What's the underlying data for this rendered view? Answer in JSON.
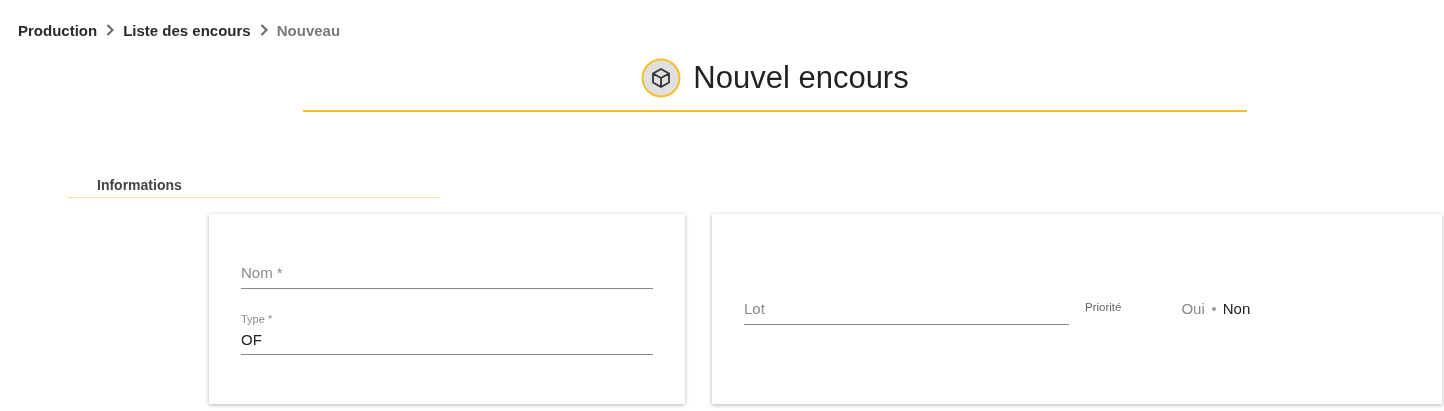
{
  "breadcrumb": [
    {
      "label": "Production",
      "current": false
    },
    {
      "label": "Liste des encours",
      "current": false
    },
    {
      "label": "Nouveau",
      "current": true
    }
  ],
  "title": "Nouvel encours",
  "section": "Informations",
  "left_card": {
    "fields": [
      {
        "kind": "empty",
        "placeholder": "Nom *"
      },
      {
        "kind": "filled",
        "label": "Type *",
        "value": "OF"
      }
    ]
  },
  "right_card": {
    "lot": {
      "placeholder": "Lot"
    },
    "priority": {
      "label": "Priorité",
      "options": [
        {
          "label": "Oui",
          "selected": false
        },
        {
          "label": "Non",
          "selected": true
        }
      ]
    }
  }
}
